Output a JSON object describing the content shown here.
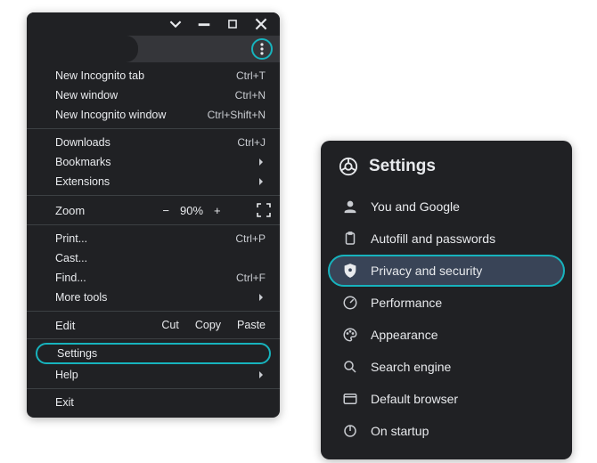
{
  "menu": {
    "items": {
      "new_incognito_tab": {
        "label": "New Incognito tab",
        "hint": "Ctrl+T"
      },
      "new_window": {
        "label": "New window",
        "hint": "Ctrl+N"
      },
      "new_incognito_window": {
        "label": "New Incognito window",
        "hint": "Ctrl+Shift+N"
      },
      "downloads": {
        "label": "Downloads",
        "hint": "Ctrl+J"
      },
      "bookmarks": {
        "label": "Bookmarks"
      },
      "extensions": {
        "label": "Extensions"
      },
      "zoom": {
        "label": "Zoom",
        "minus": "−",
        "value": "90%",
        "plus": "+"
      },
      "print": {
        "label": "Print...",
        "hint": "Ctrl+P"
      },
      "cast": {
        "label": "Cast..."
      },
      "find": {
        "label": "Find...",
        "hint": "Ctrl+F"
      },
      "more_tools": {
        "label": "More tools"
      },
      "edit": {
        "label": "Edit",
        "cut": "Cut",
        "copy": "Copy",
        "paste": "Paste"
      },
      "settings": {
        "label": "Settings"
      },
      "help": {
        "label": "Help"
      },
      "exit": {
        "label": "Exit"
      }
    }
  },
  "settings": {
    "title": "Settings",
    "items": [
      {
        "label": "You and Google"
      },
      {
        "label": "Autofill and passwords"
      },
      {
        "label": "Privacy and security"
      },
      {
        "label": "Performance"
      },
      {
        "label": "Appearance"
      },
      {
        "label": "Search engine"
      },
      {
        "label": "Default browser"
      },
      {
        "label": "On startup"
      }
    ]
  }
}
